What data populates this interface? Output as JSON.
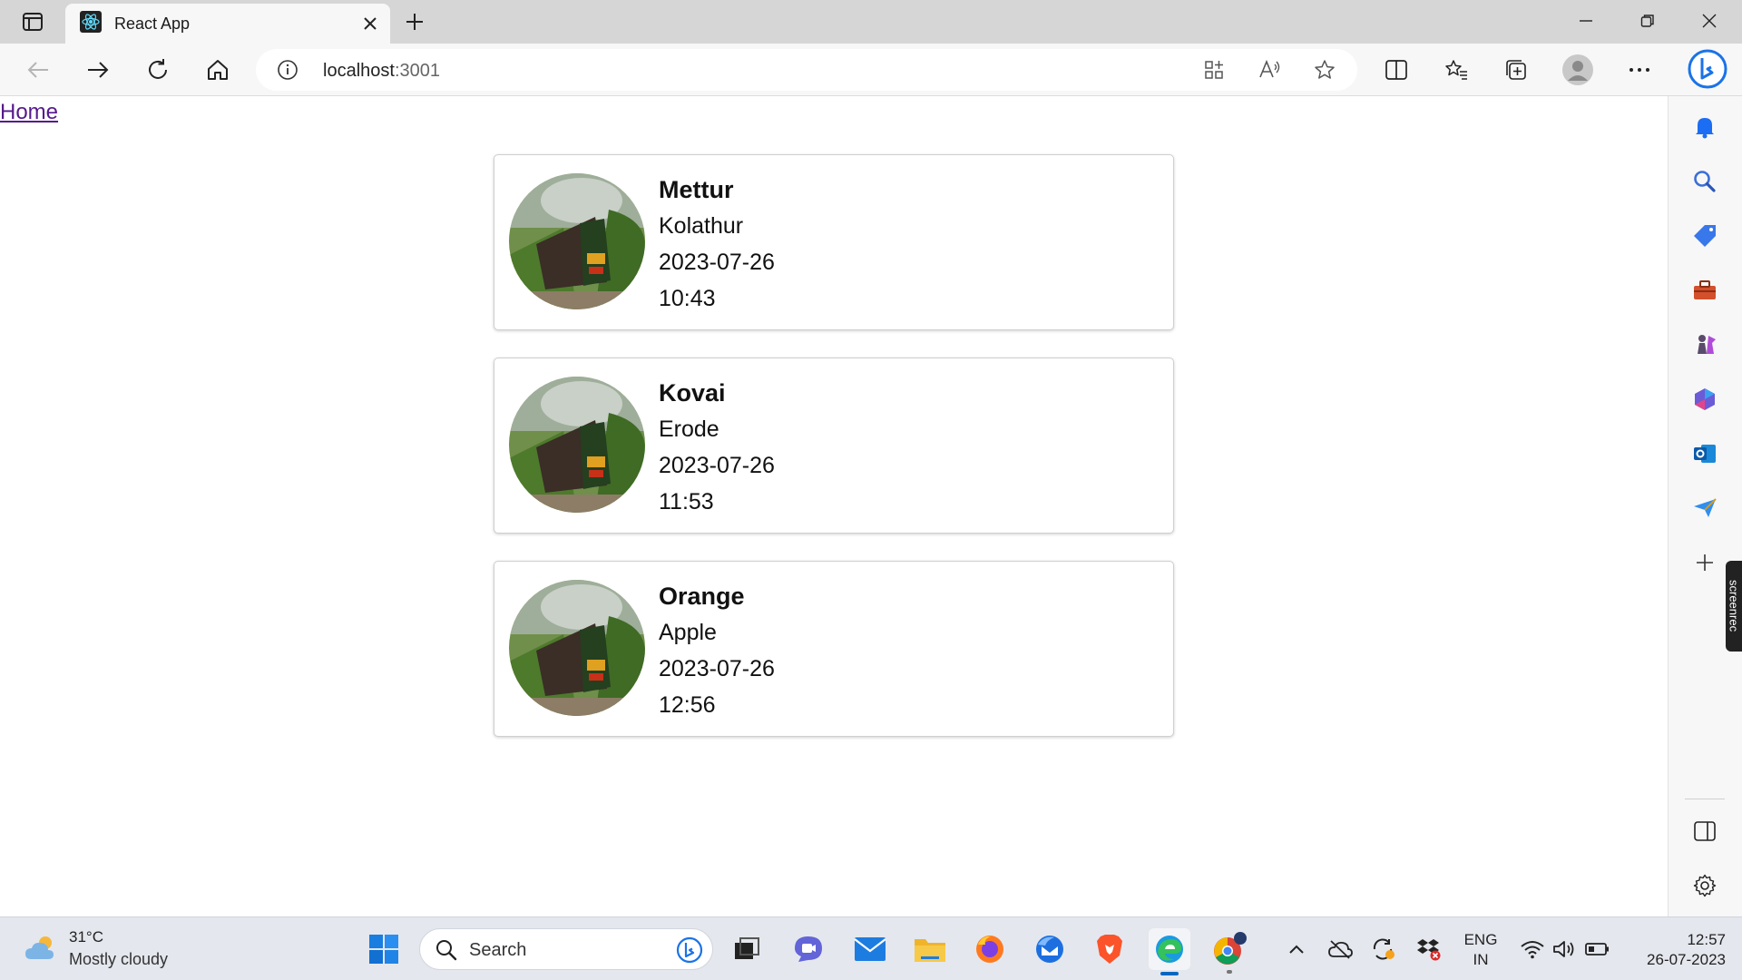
{
  "browser": {
    "tab_title": "React App",
    "address_host": "localhost",
    "address_port": ":3001"
  },
  "page": {
    "home_link": "Home",
    "cards": [
      {
        "title": "Mettur",
        "subtitle": "Kolathur",
        "date": "2023-07-26",
        "time": "10:43"
      },
      {
        "title": "Kovai",
        "subtitle": "Erode",
        "date": "2023-07-26",
        "time": "11:53"
      },
      {
        "title": "Orange",
        "subtitle": "Apple",
        "date": "2023-07-26",
        "time": "12:56"
      }
    ]
  },
  "sidebar": {
    "screenrec_label": "screenrec"
  },
  "taskbar": {
    "weather_temp": "31°C",
    "weather_desc": "Mostly cloudy",
    "search_label": "Search",
    "lang_line1": "ENG",
    "lang_line2": "IN",
    "clock_time": "12:57",
    "clock_date": "26-07-2023"
  },
  "colors": {
    "accent": "#0067c0",
    "link_visited": "#551a8b"
  }
}
